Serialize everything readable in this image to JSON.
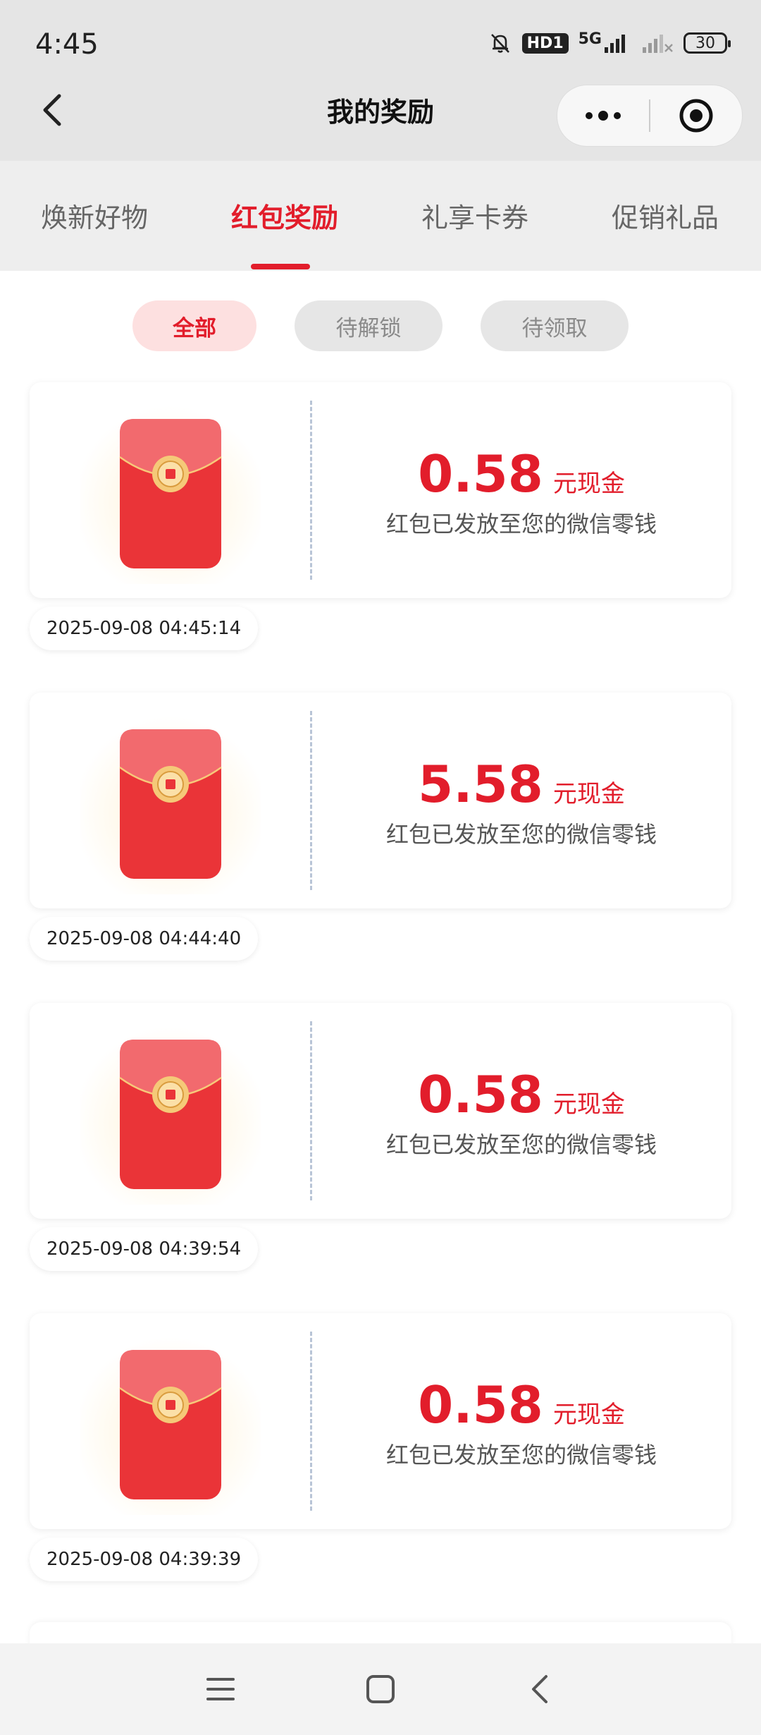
{
  "status_bar": {
    "time": "4:45",
    "hd_label": "HD1",
    "network_label": "5G",
    "battery_level": "30"
  },
  "header": {
    "title": "我的奖励"
  },
  "tabs": [
    {
      "label": "焕新好物",
      "active": false
    },
    {
      "label": "红包奖励",
      "active": true
    },
    {
      "label": "礼享卡券",
      "active": false
    },
    {
      "label": "促销礼品",
      "active": false
    }
  ],
  "filters": [
    {
      "label": "全部",
      "active": true
    },
    {
      "label": "待解锁",
      "active": false
    },
    {
      "label": "待领取",
      "active": false
    }
  ],
  "rewards": [
    {
      "amount": "0.58",
      "unit": "元现金",
      "description": "红包已发放至您的微信零钱",
      "datetime": "2025-09-08 04:45:14"
    },
    {
      "amount": "5.58",
      "unit": "元现金",
      "description": "红包已发放至您的微信零钱",
      "datetime": "2025-09-08 04:44:40"
    },
    {
      "amount": "0.58",
      "unit": "元现金",
      "description": "红包已发放至您的微信零钱",
      "datetime": "2025-09-08 04:39:54"
    },
    {
      "amount": "0.58",
      "unit": "元现金",
      "description": "红包已发放至您的微信零钱",
      "datetime": "2025-09-08 04:39:39"
    }
  ],
  "icons": {
    "envelope": "red-envelope-icon",
    "back": "chevron-left-icon",
    "more": "more-dots-icon",
    "close": "target-circle-icon",
    "nav_menu": "menu-icon",
    "nav_home": "home-square-icon",
    "nav_back": "back-arrow-icon"
  },
  "colors": {
    "accent": "#e21d2b",
    "chip_active_bg": "#fde0e0",
    "topbar_bg": "#e5e5e5",
    "tabs_bg": "#eeeeee"
  }
}
